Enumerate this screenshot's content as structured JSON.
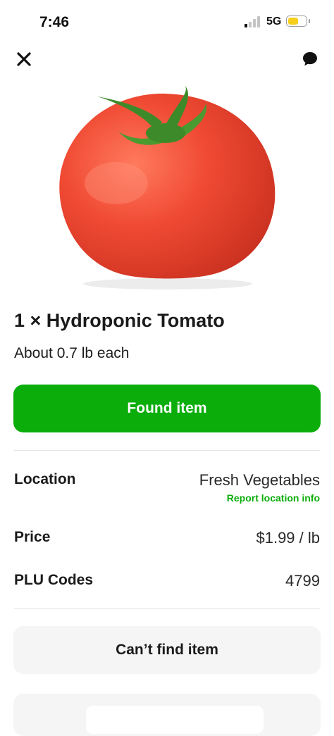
{
  "status_bar": {
    "time": "7:46",
    "network": "5G"
  },
  "icons": {
    "close": "close-icon",
    "chat": "chat-bubble-icon",
    "signal": "signal-icon",
    "battery": "battery-icon"
  },
  "battery": {
    "level": 0.6
  },
  "product": {
    "image": "tomato-image",
    "title": "1 × Hydroponic Tomato",
    "subtitle": "About 0.7 lb each"
  },
  "actions": {
    "found_label": "Found item",
    "cant_find_label": "Can’t find item"
  },
  "details": {
    "location_label": "Location",
    "location_value": "Fresh Vegetables",
    "report_link": "Report location info",
    "price_label": "Price",
    "price_value": "$1.99 / lb",
    "plu_label": "PLU Codes",
    "plu_value": "4799"
  },
  "colors": {
    "accent": "#0aad0a",
    "battery": "#f5cf1c",
    "tomato": "#ee4a34"
  }
}
